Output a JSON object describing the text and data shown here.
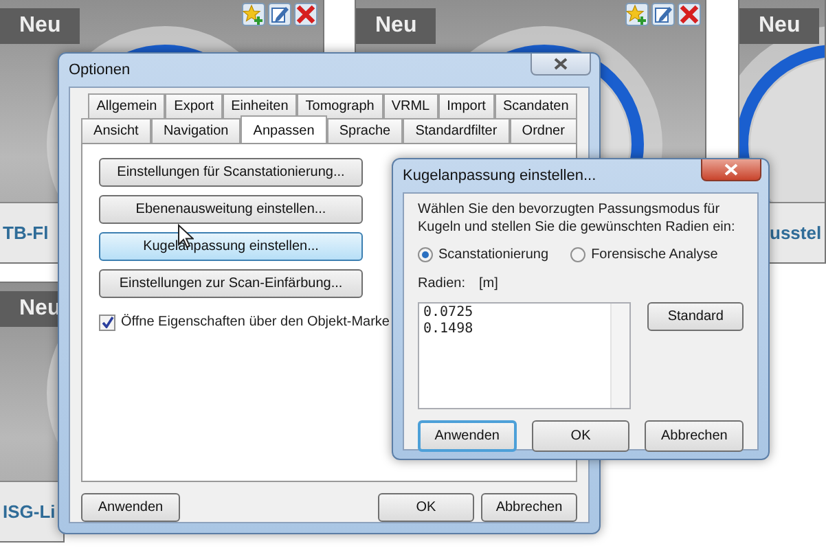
{
  "background_tiles": [
    {
      "title": "Neu",
      "label": "TB-Fl",
      "actions": true
    },
    {
      "title": "Neu",
      "actions": true
    },
    {
      "title": "Neu",
      "label": "usstel",
      "actions": false
    },
    {
      "title": "Neu",
      "label": "ISG-Li",
      "actions": false
    }
  ],
  "options_window": {
    "title": "Optionen",
    "tab_rows": [
      [
        {
          "label": "Allgemein",
          "selected": false
        },
        {
          "label": "Export",
          "selected": false
        },
        {
          "label": "Einheiten",
          "selected": false
        },
        {
          "label": "Tomograph",
          "selected": false
        },
        {
          "label": "VRML",
          "selected": false
        },
        {
          "label": "Import",
          "selected": false
        },
        {
          "label": "Scandaten",
          "selected": false
        }
      ],
      [
        {
          "label": "Ansicht",
          "selected": false
        },
        {
          "label": "Navigation",
          "selected": false
        },
        {
          "label": "Anpassen",
          "selected": true
        },
        {
          "label": "Sprache",
          "selected": false
        },
        {
          "label": "Standardfilter",
          "selected": false
        },
        {
          "label": "Ordner",
          "selected": false
        }
      ]
    ],
    "buttons": [
      {
        "label": "Einstellungen für Scanstationierung...",
        "hovered": false
      },
      {
        "label": "Ebenenausweitung einstellen...",
        "hovered": false
      },
      {
        "label": "Kugelanpassung einstellen...",
        "hovered": true
      },
      {
        "label": "Einstellungen zur Scan-Einfärbung...",
        "hovered": false
      }
    ],
    "checkbox": {
      "label": "Öffne Eigenschaften über den Objekt-Marke",
      "checked": true
    },
    "footer_buttons": [
      "Anwenden",
      "OK",
      "Abbrechen"
    ]
  },
  "sphere_dialog": {
    "title": "Kugelanpassung einstellen...",
    "instructions": "Wählen Sie den bevorzugten Passungsmodus für Kugeln und stellen Sie die gewünschten Radien ein:",
    "radios": [
      {
        "label": "Scanstationierung",
        "selected": true
      },
      {
        "label": "Forensische Analyse",
        "selected": false
      }
    ],
    "radii_label": "Radien:",
    "unit": "[m]",
    "radii": "0.0725\n0.1498",
    "standard_button": "Standard",
    "buttons": [
      {
        "label": "Anwenden",
        "focused": true
      },
      {
        "label": "OK",
        "focused": false
      },
      {
        "label": "Abbrechen",
        "focused": false
      }
    ]
  }
}
